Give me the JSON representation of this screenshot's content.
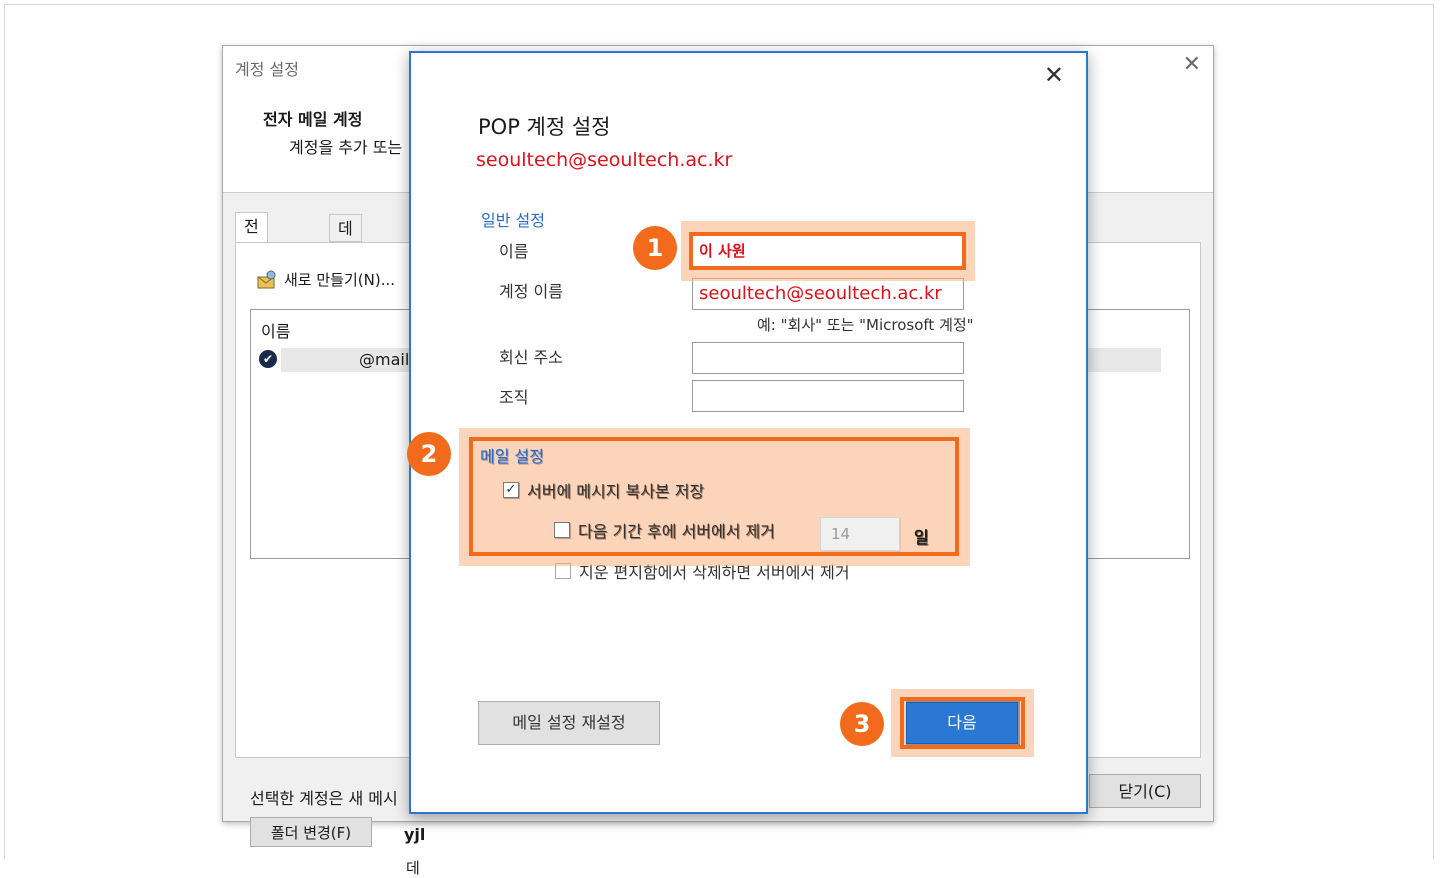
{
  "background_window": {
    "title": "계정 설정",
    "heading": "전자 메일 계정",
    "subtitle": "계정을 추가 또는",
    "tabs": [
      "전자 메일",
      "데이터 파"
    ],
    "new_button": "새로 만들기(N)...",
    "list_header": "이름",
    "account_email": "@mail",
    "selected_note": "선택한 계정은 새 메시",
    "folder_button": "폴더 변경(F)",
    "folder_name": "yjl",
    "folder_desc": "데",
    "close_button": "닫기(C)"
  },
  "dialog": {
    "title": "POP 계정 설정",
    "email": "seoultech@seoultech.ac.kr",
    "general_section": "일반 설정",
    "name_label": "이름",
    "name_value": "이 사원",
    "account_name_label": "계정 이름",
    "account_name_value": "seoultech@seoultech.ac.kr",
    "account_hint": "예: \"회사\" 또는 \"Microsoft 계정\"",
    "reply_label": "회신 주소",
    "reply_value": "",
    "org_label": "조직",
    "org_value": "",
    "mail_section": "메일 설정",
    "keep_copy_label": "서버에 메시지 복사본 저장",
    "keep_copy_checked": true,
    "remove_after_label": "다음 기간 후에 서버에서 제거",
    "remove_after_checked": false,
    "days_value": "14",
    "days_unit": "일",
    "remove_deleted_label": "지운 편지함에서 삭제하면 서버에서 제거",
    "remove_deleted_checked": false,
    "reset_button": "메일 설정 재설정",
    "next_button": "다음"
  },
  "annotations": {
    "badge1": "1",
    "badge2": "2",
    "badge3": "3",
    "accent_color": "#f26b1d"
  }
}
